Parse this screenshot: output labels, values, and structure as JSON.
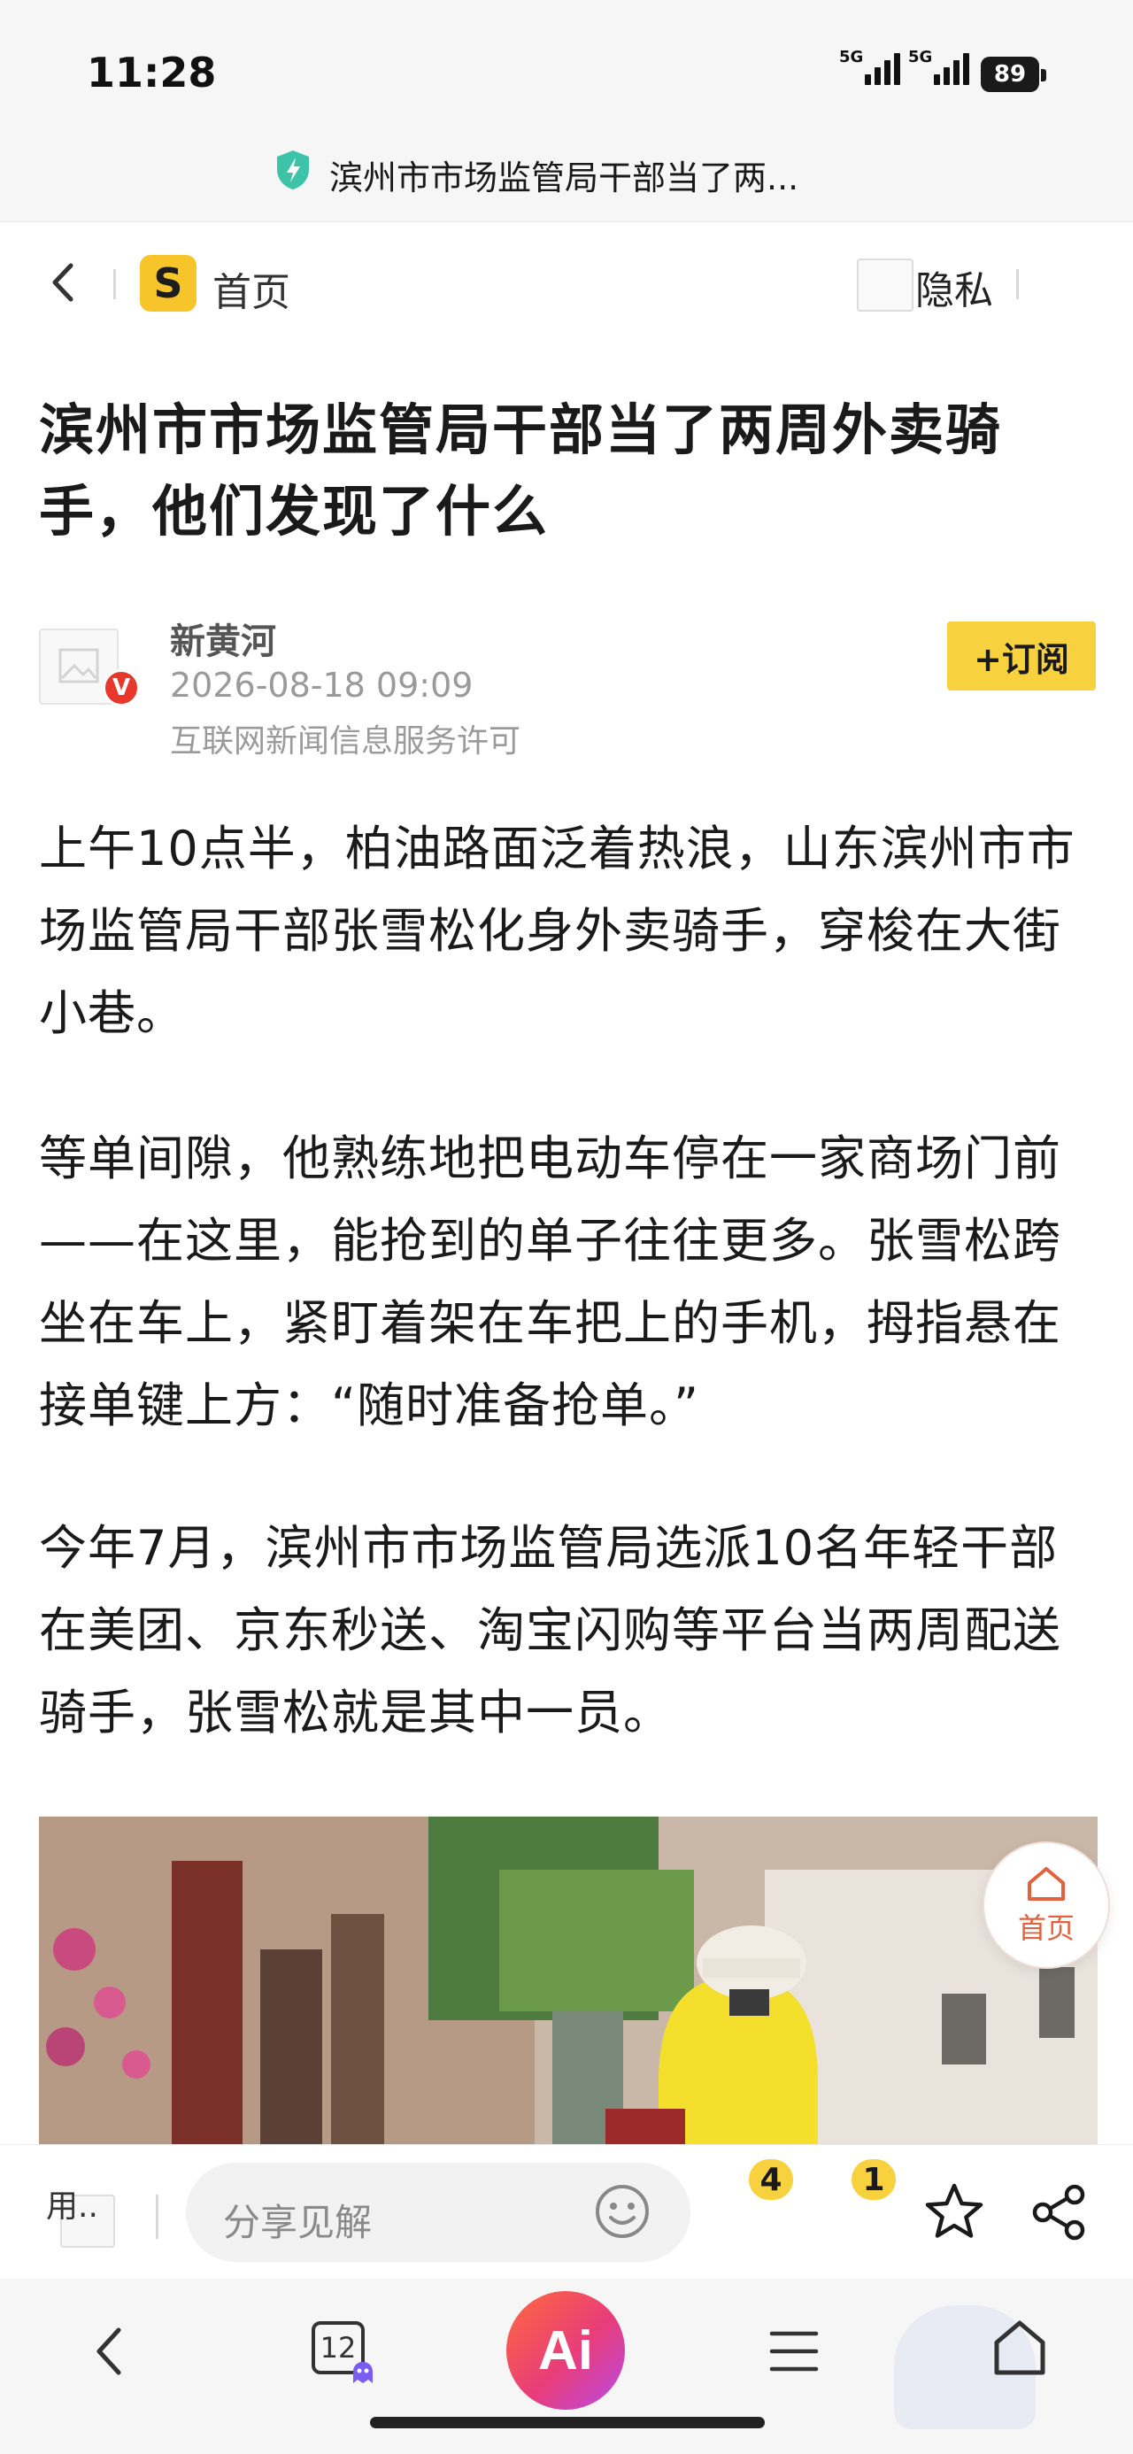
{
  "status_bar": {
    "time": "11:28",
    "network_1": "5G",
    "network_2": "5G",
    "battery": "89"
  },
  "url_bar": {
    "title": "滨州市市场监管局干部当了两..."
  },
  "nav": {
    "home_label": "首页",
    "home_logo": "S",
    "privacy_label": "隐私"
  },
  "article": {
    "headline": "滨州市市场监管局干部当了两周外卖骑手，他们发现了什么",
    "author": {
      "name": "新黄河",
      "verified_badge": "V",
      "time": "2026-08-18 09:09",
      "license": "互联网新闻信息服务许可"
    },
    "subscribe_label": "+订阅",
    "paragraphs": [
      "上午10点半，柏油路面泛着热浪，山东滨州市市场监管局干部张雪松化身外卖骑手，穿梭在大街小巷。",
      "等单间隙，他熟练地把电动车停在一家商场门前——在这里，能抢到的单子往往更多。张雪松跨坐在车上，紧盯着架在车把上的手机，拇指悬在接单键上方：“随时准备抢单。”",
      "今年7月，滨州市市场监管局选派10名年轻干部在美团、京东秒送、淘宝闪购等平台当两周配送骑手，张雪松就是其中一员。"
    ]
  },
  "float_home": {
    "label": "首页"
  },
  "bottom_bar": {
    "use_label": "用..",
    "share_placeholder": "分享见解",
    "comment_count": "4",
    "like_count": "1"
  },
  "system_nav": {
    "tabs_count": "12",
    "ai_label": "Ai"
  },
  "colors": {
    "accent_yellow": "#f7d23e",
    "verified_red": "#e8372b",
    "float_home_orange": "#e2623d"
  }
}
